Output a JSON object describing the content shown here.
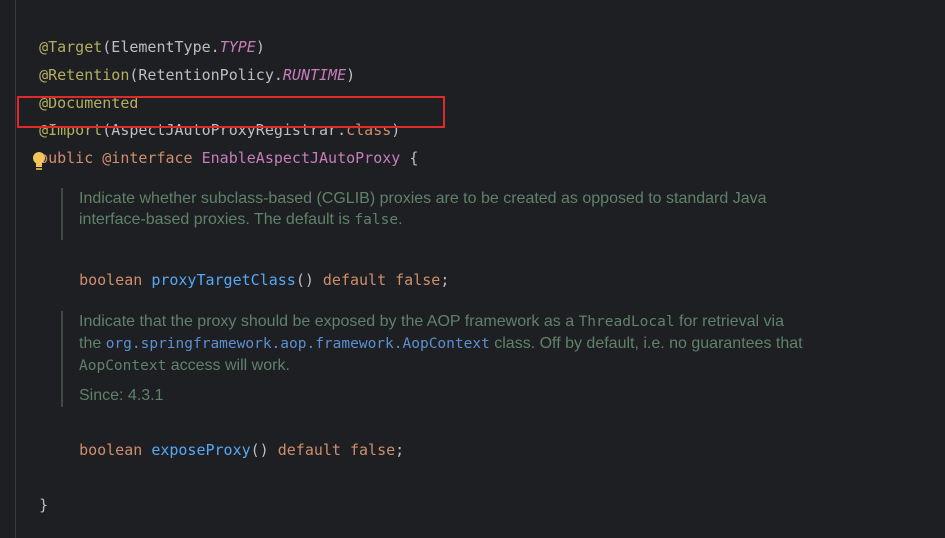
{
  "code": {
    "line1": {
      "at": "@Target",
      "p1": "(ElementType.",
      "val": "TYPE",
      "p2": ")"
    },
    "line2": {
      "at": "@Retention",
      "p1": "(RetentionPolicy.",
      "val": "RUNTIME",
      "p2": ")"
    },
    "line3": {
      "at": "@Documented"
    },
    "line4": {
      "at": "@Import",
      "p1": "(AspectJAutoProxyRegistrar.",
      "val": "class",
      "p2": ")"
    },
    "line5": {
      "kw1": "public",
      "kw2": "@interface",
      "name": "EnableAspectJAutoProxy",
      "brace": "{"
    },
    "doc1": {
      "text1": "Indicate whether subclass-based (CGLIB) proxies are to be created as opposed to standard Java",
      "text2": "interface-based proxies. The default is ",
      "code": "false",
      "text3": "."
    },
    "method1": {
      "type": "boolean",
      "name": "proxyTargetClass",
      "paren": "()",
      "kw": "default",
      "val": "false",
      "semi": ";"
    },
    "doc2": {
      "text1": "Indicate that the proxy should be exposed by the AOP framework as a ",
      "code1": "ThreadLocal",
      "text2": " for retrieval via",
      "text3": "the ",
      "link": "org.springframework.aop.framework.AopContext",
      "text4": " class. Off by default, i.e. no guarantees that",
      "code2": "AopContext",
      "text5": " access will work.",
      "since_label": "Since:",
      "since_value": "4.3.1"
    },
    "method2": {
      "type": "boolean",
      "name": "exposeProxy",
      "paren": "()",
      "kw": "default",
      "val": "false",
      "semi": ";"
    },
    "close": "}"
  }
}
